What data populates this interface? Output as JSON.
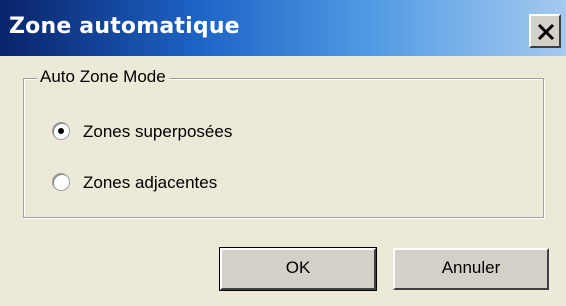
{
  "window": {
    "title": "Zone automatique",
    "close_icon": "close-icon"
  },
  "group": {
    "legend": "Auto Zone Mode",
    "options": [
      {
        "label": "Zones superposées",
        "selected": true
      },
      {
        "label": "Zones adjacentes",
        "selected": false
      }
    ]
  },
  "buttons": {
    "ok": "OK",
    "cancel": "Annuler"
  },
  "colors": {
    "titlebar_start": "#0a246a",
    "titlebar_end": "#a6caf0",
    "face": "#ece9d8"
  }
}
